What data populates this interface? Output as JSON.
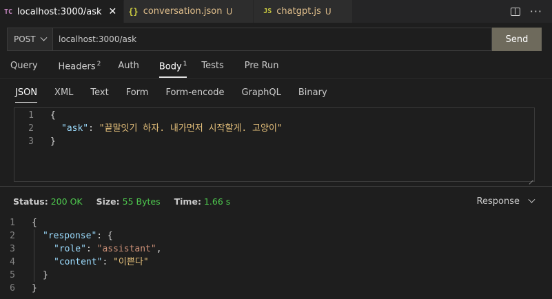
{
  "tabs": [
    {
      "icon": "TC",
      "label": "localhost:3000/ask",
      "active": true,
      "close": "✕"
    },
    {
      "icon": "{}",
      "label": "conversation.json",
      "badge": "U"
    },
    {
      "icon": "JS",
      "label": "chatgpt.js",
      "badge": "U"
    }
  ],
  "request": {
    "method": "POST",
    "url": "localhost:3000/ask",
    "send_label": "Send"
  },
  "request_tabs": [
    {
      "label": "Query"
    },
    {
      "label": "Headers",
      "count": "2"
    },
    {
      "label": "Auth"
    },
    {
      "label": "Body",
      "count": "1",
      "active": true
    },
    {
      "label": "Tests"
    },
    {
      "label": "Pre Run"
    }
  ],
  "body_formats": [
    "JSON",
    "XML",
    "Text",
    "Form",
    "Form-encode",
    "GraphQL",
    "Binary"
  ],
  "body_editor": {
    "line_numbers": [
      "1",
      "2",
      "3"
    ],
    "open": "{",
    "key": "\"ask\"",
    "colon": ": ",
    "value": "\"끝말잇기 하자. 내가먼저 시작할게. 고양이\"",
    "close": "}"
  },
  "status": {
    "status_label": "Status:",
    "status_value": "200 OK",
    "size_label": "Size:",
    "size_value": "55 Bytes",
    "time_label": "Time:",
    "time_value": "1.66 s"
  },
  "response_view": {
    "label": "Response"
  },
  "response_body": {
    "line_numbers": [
      "1",
      "2",
      "3",
      "4",
      "5",
      "6"
    ],
    "l1": "{",
    "response_key": "\"response\"",
    "l2_tail": ": {",
    "role_key": "\"role\"",
    "role_value": "\"assistant\"",
    "content_key": "\"content\"",
    "content_value": "\"이쁜다\"",
    "l5": "}",
    "l6": "}"
  },
  "colors": {
    "accent_send": "#6e6a5c",
    "status_ok": "#4ec94e",
    "json_key": "#9cdcfe",
    "json_string": "#ce9178"
  }
}
